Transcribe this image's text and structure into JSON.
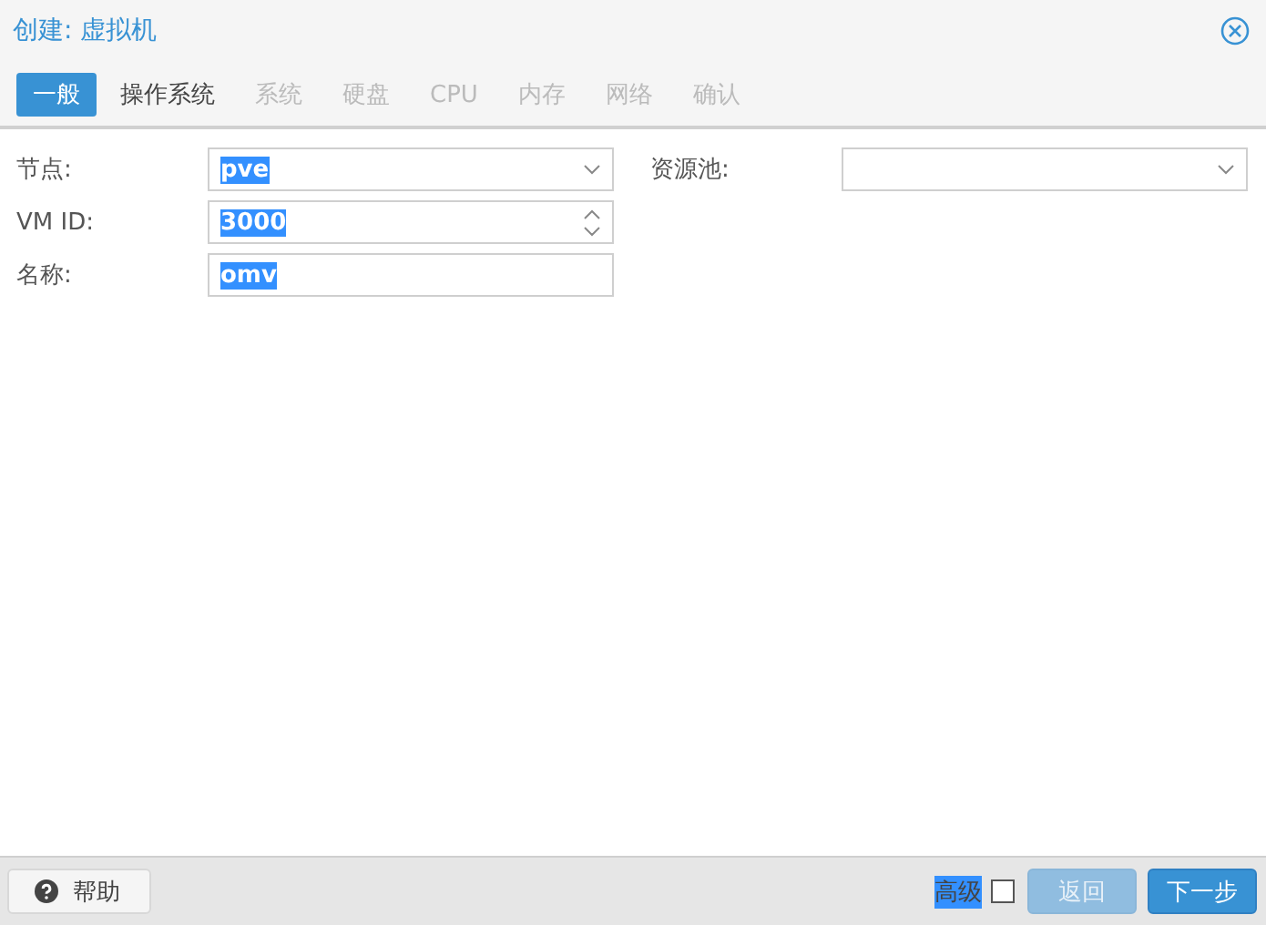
{
  "window": {
    "title": "创建: 虚拟机"
  },
  "tabs": [
    {
      "label": "一般",
      "selected": true,
      "disabled": false
    },
    {
      "label": "操作系统",
      "selected": false,
      "disabled": false
    },
    {
      "label": "系统",
      "selected": false,
      "disabled": true
    },
    {
      "label": "硬盘",
      "selected": false,
      "disabled": true
    },
    {
      "label": "CPU",
      "selected": false,
      "disabled": true
    },
    {
      "label": "内存",
      "selected": false,
      "disabled": true
    },
    {
      "label": "网络",
      "selected": false,
      "disabled": true
    },
    {
      "label": "确认",
      "selected": false,
      "disabled": true
    }
  ],
  "left_fields": [
    {
      "label": "节点:",
      "kind": "select",
      "value": "pve",
      "text_selected": true
    },
    {
      "label": "VM ID:",
      "kind": "spinner",
      "value": "3000",
      "text_selected": true
    },
    {
      "label": "名称:",
      "kind": "text",
      "value": "omv",
      "text_selected": true
    }
  ],
  "right_fields": [
    {
      "label": "资源池:",
      "kind": "select"
    }
  ],
  "footer": {
    "help": "帮助",
    "advanced": {
      "label": "高级",
      "checked": false,
      "text_selected": true
    },
    "buttons": [
      {
        "label": "返回",
        "disabled": true
      },
      {
        "label": "下一步",
        "disabled": false
      }
    ]
  }
}
